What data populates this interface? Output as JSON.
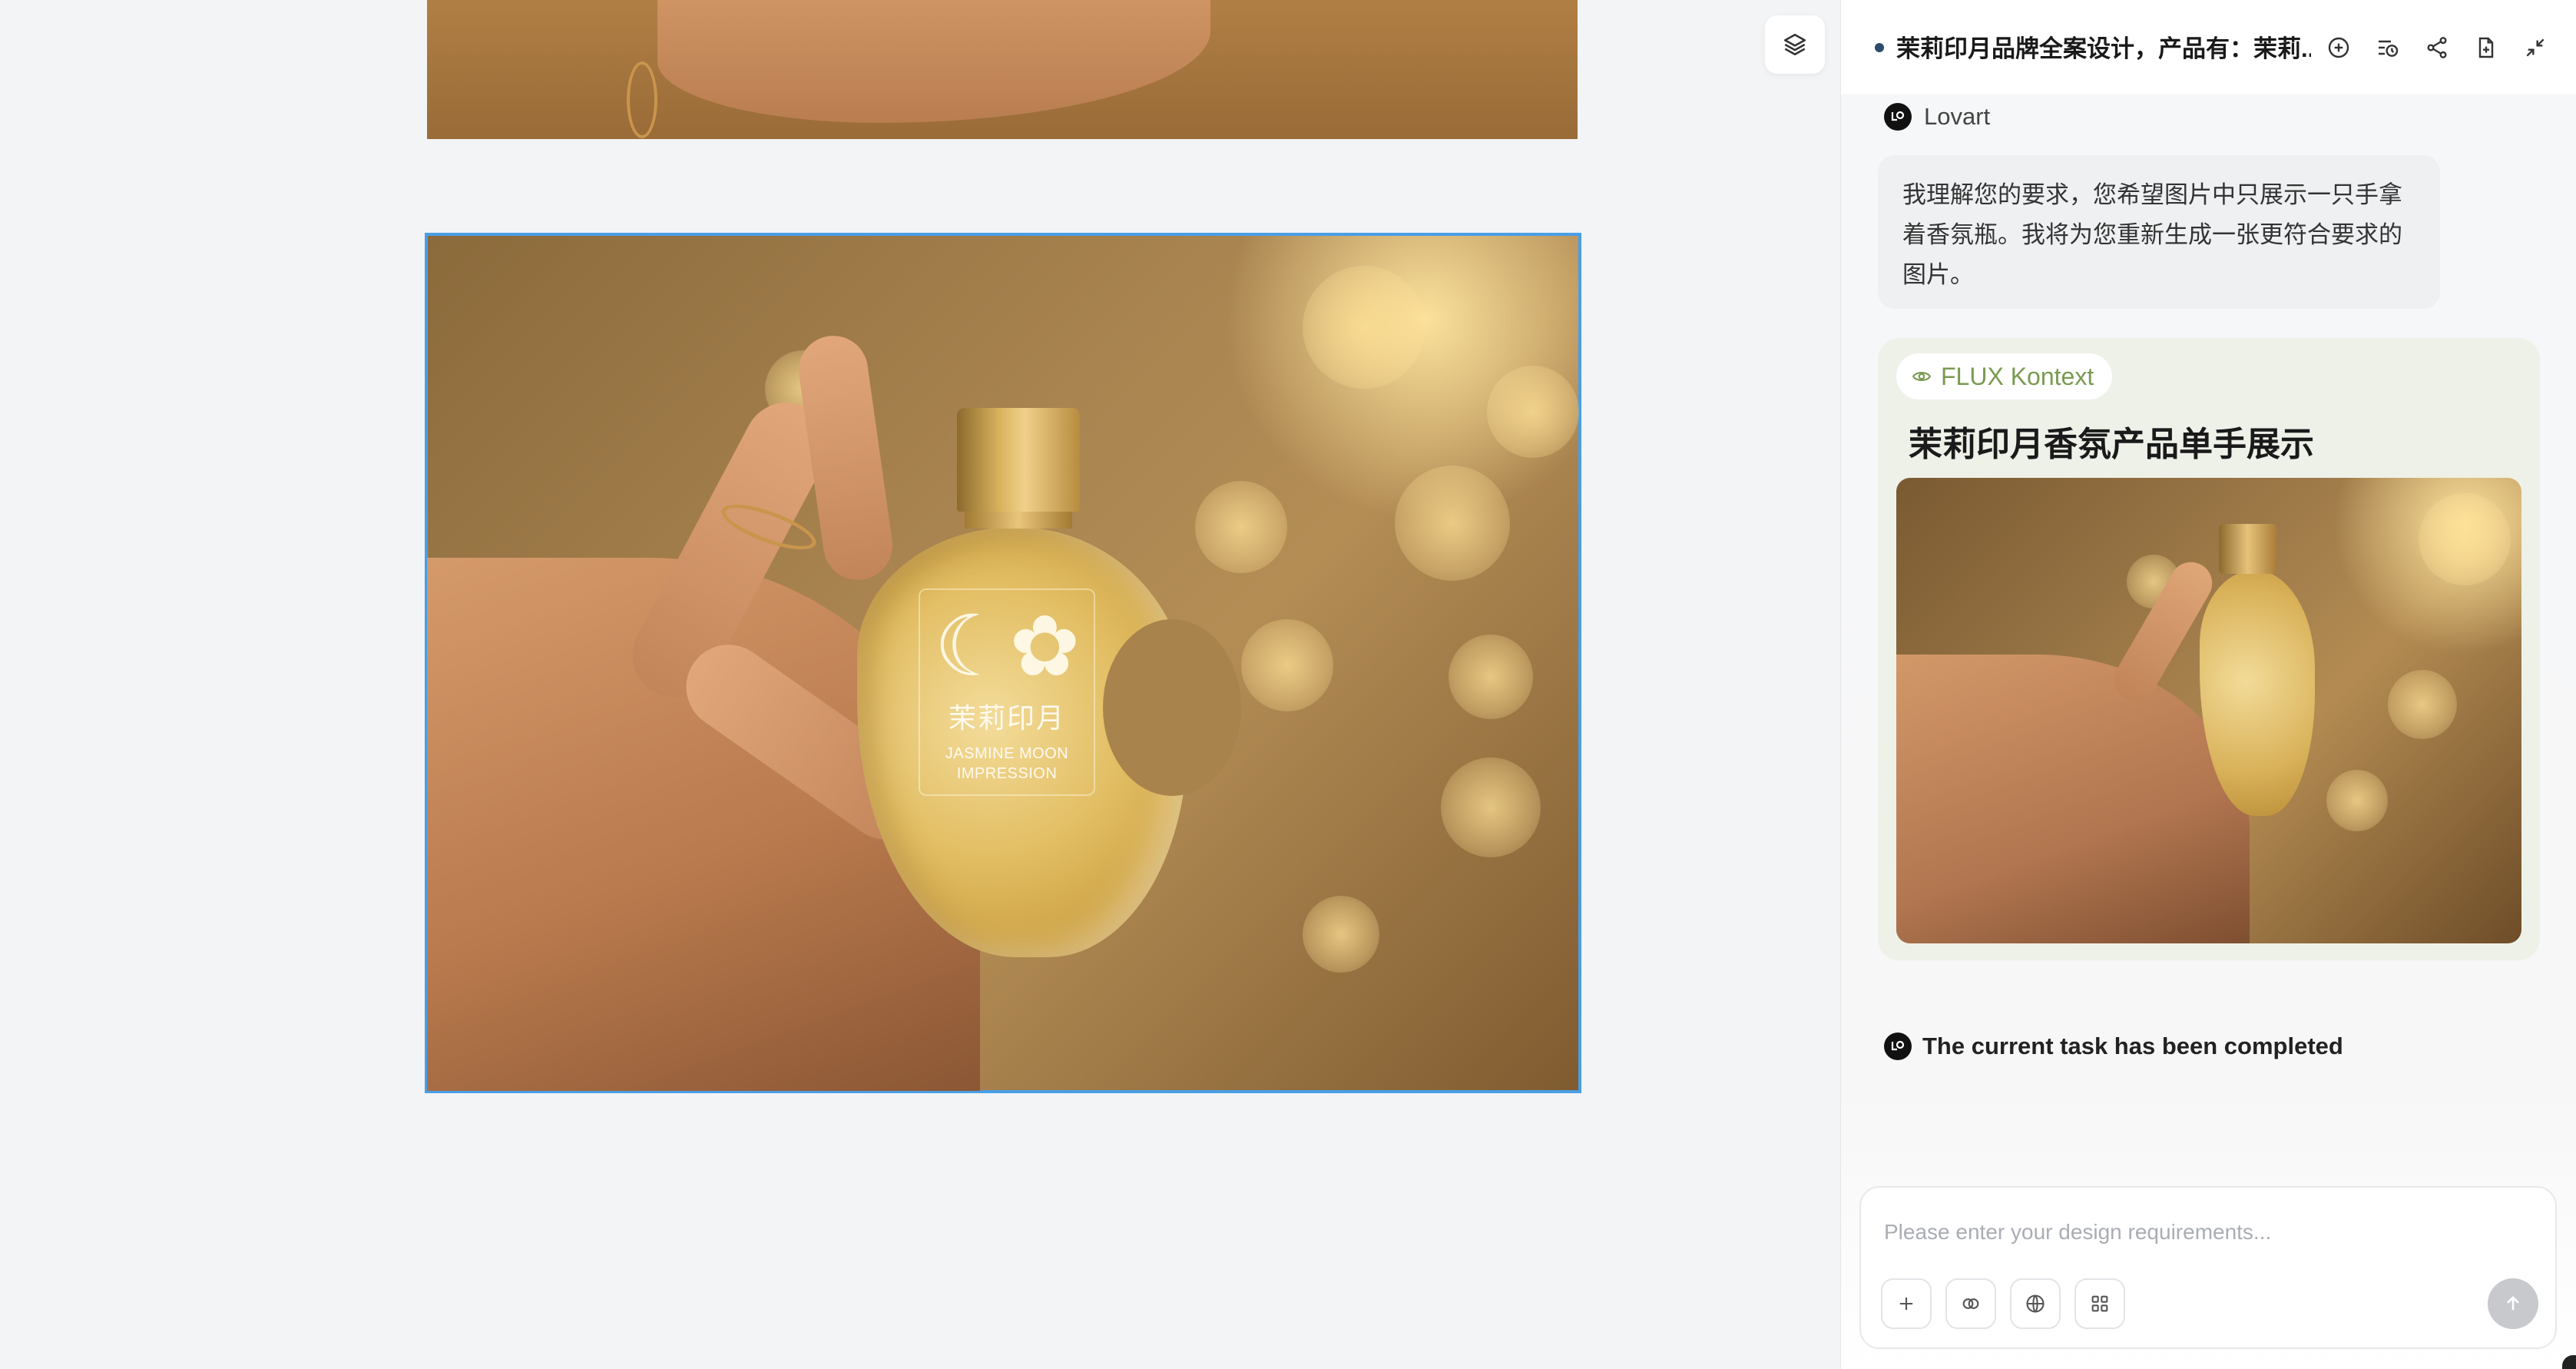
{
  "header": {
    "title": "茉莉印月品牌全案设计，产品有：茉莉...",
    "icons": [
      "add-chat-icon",
      "history-icon",
      "share-icon",
      "export-icon",
      "collapse-icon"
    ]
  },
  "canvas": {
    "layers_icon": "layers-icon",
    "bottle_label": {
      "cn": "茉莉印月",
      "en_line1": "JASMINE MOON",
      "en_line2": "IMPRESSION"
    }
  },
  "chat": {
    "sender_name": "Lovart",
    "message": "我理解您的要求，您希望图片中只展示一只手拿着香氛瓶。我将为您重新生成一张更符合要求的图片。",
    "tool_badge": "FLUX Kontext",
    "result_title": "茉莉印月香氛产品单手展示",
    "status": "The current task has been completed"
  },
  "composer": {
    "placeholder": "Please enter your design requirements...",
    "tools": [
      "plus-icon",
      "link-icon",
      "globe-icon",
      "grid-icon"
    ],
    "send_icon": "arrow-up-icon"
  },
  "colors": {
    "selection_outline": "#4a9ee6",
    "flux_card_bg": "#eef1e8",
    "flux_badge_text": "#7a9a52",
    "send_button": "#c7c9cd"
  }
}
